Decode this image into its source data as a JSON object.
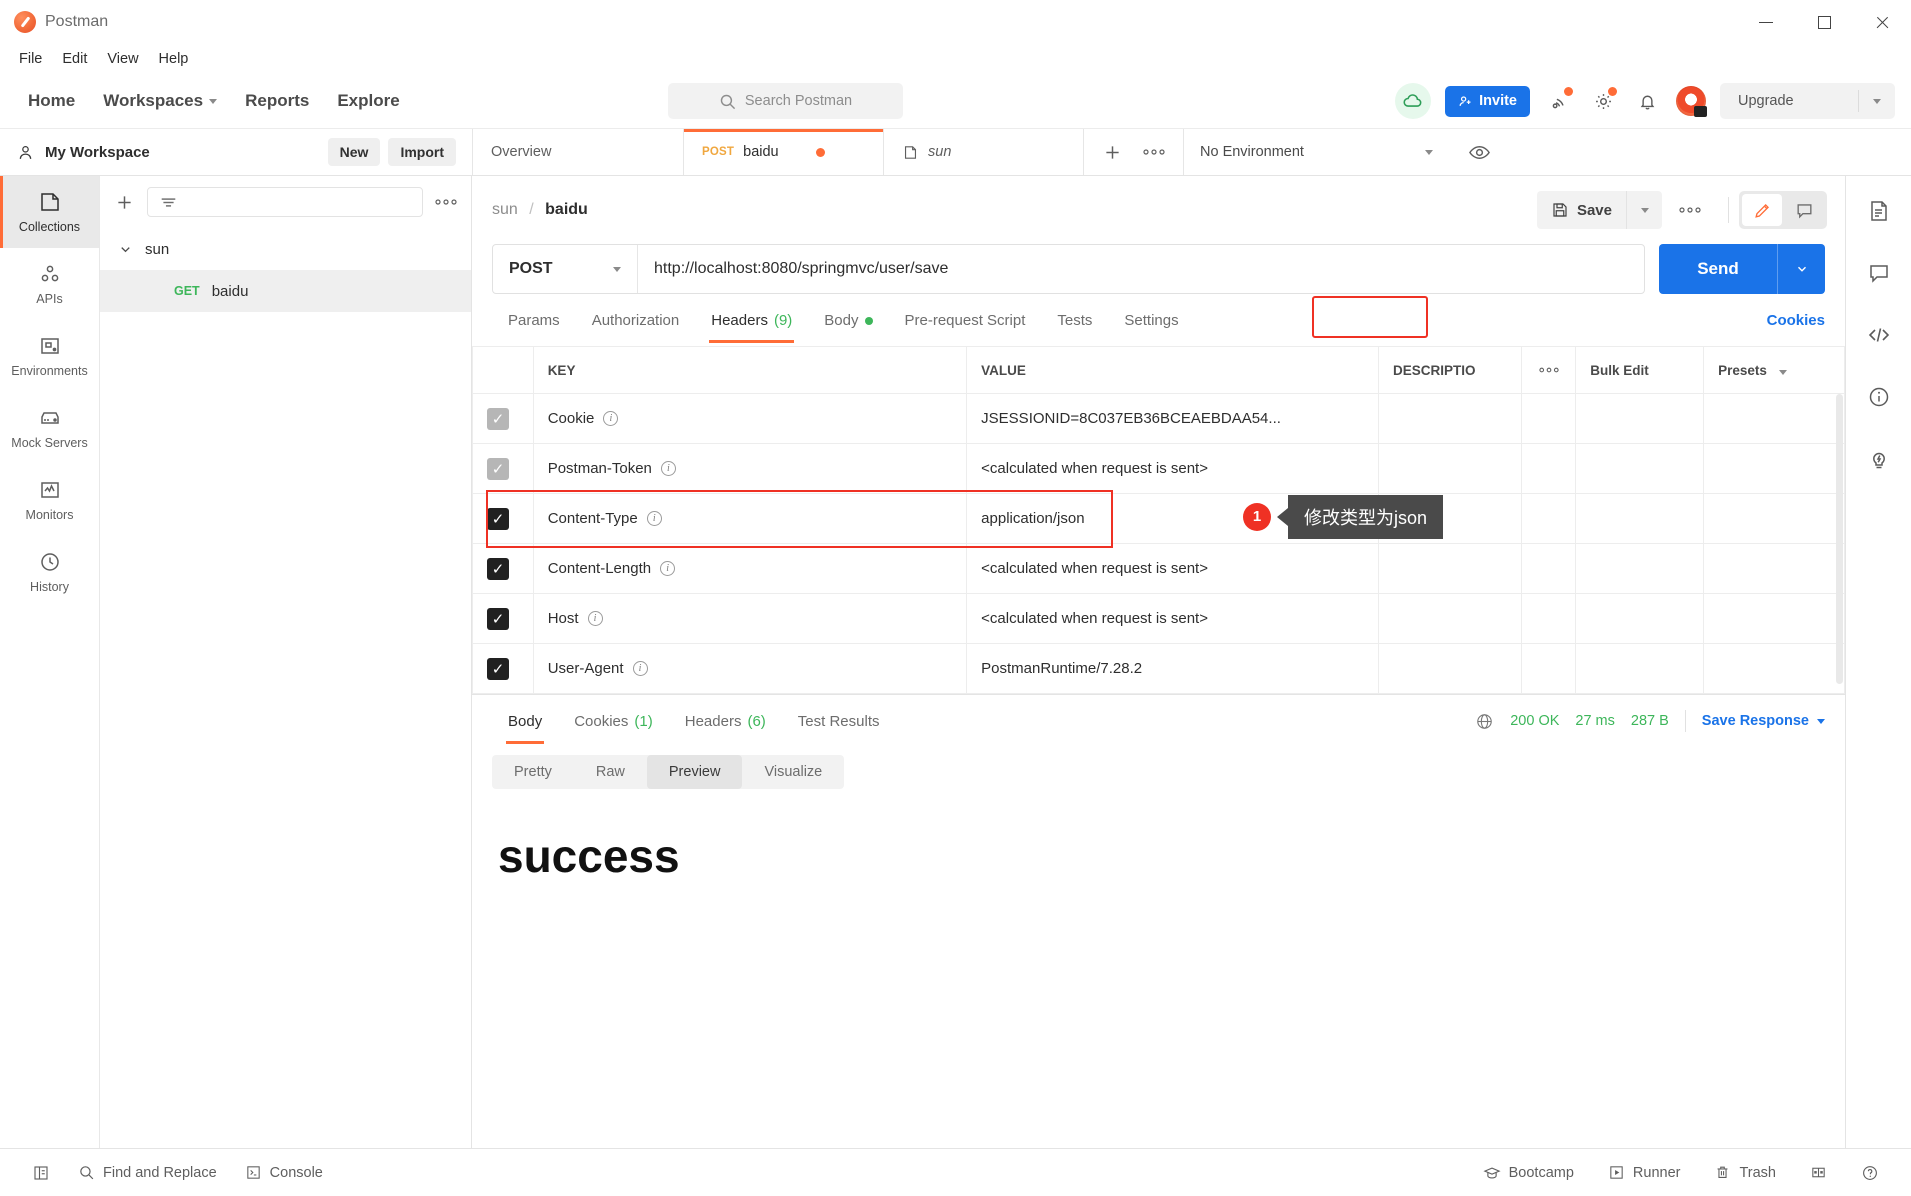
{
  "window": {
    "title": "Postman",
    "minimize": "minimize",
    "maximize": "maximize",
    "close": "close"
  },
  "menubar": {
    "items": [
      "File",
      "Edit",
      "View",
      "Help"
    ]
  },
  "navbar": {
    "items": [
      "Home",
      "Workspaces",
      "Reports",
      "Explore"
    ],
    "search_placeholder": "Search Postman",
    "invite_label": "Invite",
    "upgrade_label": "Upgrade"
  },
  "workspace": {
    "name": "My Workspace",
    "new_label": "New",
    "import_label": "Import",
    "environment_label": "No Environment"
  },
  "tabs": [
    {
      "label": "Overview",
      "verb": "",
      "active": false
    },
    {
      "label": "baidu",
      "verb": "POST",
      "active": true,
      "unsaved": true
    },
    {
      "label": "sun",
      "verb": "",
      "active": false
    }
  ],
  "rail": [
    {
      "label": "Collections",
      "icon": "collections-icon",
      "active": true
    },
    {
      "label": "APIs",
      "icon": "apis-icon",
      "active": false
    },
    {
      "label": "Environments",
      "icon": "environments-icon",
      "active": false
    },
    {
      "label": "Mock Servers",
      "icon": "mock-servers-icon",
      "active": false
    },
    {
      "label": "Monitors",
      "icon": "monitors-icon",
      "active": false
    },
    {
      "label": "History",
      "icon": "history-icon",
      "active": false
    }
  ],
  "sidebar": {
    "collection": "sun",
    "request": {
      "verb": "GET",
      "name": "baidu"
    }
  },
  "request": {
    "breadcrumb_collection": "sun",
    "breadcrumb_name": "baidu",
    "save_label": "Save",
    "method": "POST",
    "url": "http://localhost:8080/springmvc/user/save",
    "send_label": "Send",
    "tabs": [
      {
        "label": "Params",
        "count": "",
        "active": false
      },
      {
        "label": "Authorization",
        "count": "",
        "active": false
      },
      {
        "label": "Headers",
        "count": "(9)",
        "active": true,
        "highlighted": true
      },
      {
        "label": "Body",
        "count": "",
        "active": false,
        "dot": true
      },
      {
        "label": "Pre-request Script",
        "count": "",
        "active": false
      },
      {
        "label": "Tests",
        "count": "",
        "active": false
      },
      {
        "label": "Settings",
        "count": "",
        "active": false
      }
    ],
    "cookies_link": "Cookies"
  },
  "headers_table": {
    "columns": [
      "KEY",
      "VALUE",
      "DESCRIPTIO"
    ],
    "bulk_edit_label": "Bulk Edit",
    "presets_label": "Presets",
    "rows": [
      {
        "checked": "partial",
        "key": "Cookie",
        "value": "JSESSIONID=8C037EB36BCEAEBDAA54...",
        "description": ""
      },
      {
        "checked": "partial",
        "key": "Postman-Token",
        "value": "<calculated when request is sent>",
        "description": ""
      },
      {
        "checked": "on",
        "key": "Content-Type",
        "value": "application/json",
        "description": "",
        "highlighted": true
      },
      {
        "checked": "on",
        "key": "Content-Length",
        "value": "<calculated when request is sent>",
        "description": ""
      },
      {
        "checked": "on",
        "key": "Host",
        "value": "<calculated when request is sent>",
        "description": ""
      },
      {
        "checked": "on",
        "key": "User-Agent",
        "value": "PostmanRuntime/7.28.2",
        "description": ""
      }
    ]
  },
  "annotation": {
    "number": "1",
    "text": "修改类型为json"
  },
  "response": {
    "tabs": [
      {
        "label": "Body",
        "count": "",
        "active": true
      },
      {
        "label": "Cookies",
        "count": "(1)",
        "active": false
      },
      {
        "label": "Headers",
        "count": "(6)",
        "active": false
      },
      {
        "label": "Test Results",
        "count": "",
        "active": false
      }
    ],
    "status": "200 OK",
    "time": "27 ms",
    "size": "287 B",
    "save_response_label": "Save Response",
    "format_tabs": [
      {
        "label": "Pretty",
        "active": false
      },
      {
        "label": "Raw",
        "active": false
      },
      {
        "label": "Preview",
        "active": true
      },
      {
        "label": "Visualize",
        "active": false
      }
    ],
    "preview_text": "success"
  },
  "right_rail": [
    "documentation-icon",
    "comment-icon",
    "code-icon",
    "info-icon",
    "lightbulb-icon"
  ],
  "statusbar": {
    "left": [
      {
        "label": "",
        "icon": "sidebar-toggle-icon"
      },
      {
        "label": "Find and Replace",
        "icon": "search-icon"
      },
      {
        "label": "Console",
        "icon": "console-icon"
      }
    ],
    "right": [
      {
        "label": "Bootcamp",
        "icon": "bootcamp-icon"
      },
      {
        "label": "Runner",
        "icon": "runner-icon"
      },
      {
        "label": "Trash",
        "icon": "trash-icon"
      },
      {
        "label": "",
        "icon": "layout-icon"
      },
      {
        "label": "",
        "icon": "help-icon"
      }
    ]
  },
  "colors": {
    "accent": "#ff6c37",
    "blue": "#1a73e8",
    "green": "#3db65a",
    "red": "#ef3124"
  }
}
